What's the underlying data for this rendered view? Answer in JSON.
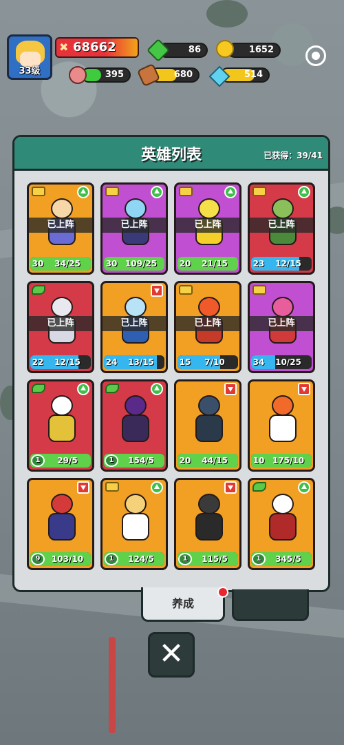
{
  "player": {
    "level_label": "33级",
    "power": "68662"
  },
  "resources": {
    "gems": "86",
    "coins": "1652",
    "meat": "395",
    "wood": "680",
    "crystal": "514"
  },
  "panel": {
    "title": "英雄列表",
    "obtained": "已获得：39/41"
  },
  "heroes": [
    {
      "color": "orange",
      "badge": "book",
      "arrow": "up",
      "deployed": "已上阵",
      "level": "30",
      "frags": "34/25",
      "bar": "green",
      "progress": 1.0
    },
    {
      "color": "purple",
      "badge": "book",
      "arrow": "up",
      "deployed": "已上阵",
      "level": "30",
      "frags": "109/25",
      "bar": "green",
      "progress": 1.0
    },
    {
      "color": "purple",
      "badge": "book",
      "arrow": "up",
      "deployed": "已上阵",
      "level": "20",
      "frags": "21/15",
      "bar": "green",
      "progress": 1.0
    },
    {
      "color": "red",
      "badge": "book",
      "arrow": "up",
      "deployed": "已上阵",
      "level": "23",
      "frags": "12/15",
      "bar": "blue",
      "progress": 0.8
    },
    {
      "color": "red",
      "badge": "leaf",
      "arrow": "",
      "deployed": "已上阵",
      "level": "22",
      "frags": "12/15",
      "bar": "blue",
      "progress": 0.8
    },
    {
      "color": "orange",
      "badge": "",
      "arrow": "down",
      "deployed": "已上阵",
      "level": "24",
      "frags": "13/15",
      "bar": "blue",
      "progress": 0.87
    },
    {
      "color": "orange",
      "badge": "book",
      "arrow": "",
      "deployed": "已上阵",
      "level": "15",
      "frags": "7/10",
      "bar": "blue",
      "progress": 0.7
    },
    {
      "color": "purple",
      "badge": "book",
      "arrow": "",
      "deployed": "已上阵",
      "level": "34",
      "frags": "10/25",
      "bar": "blue",
      "progress": 0.4
    },
    {
      "color": "red",
      "badge": "leaf",
      "arrow": "up",
      "deployed": "",
      "level": "1",
      "frags": "29/5",
      "bar": "green",
      "progress": 1.0
    },
    {
      "color": "red",
      "badge": "leaf",
      "arrow": "up",
      "deployed": "",
      "level": "1",
      "frags": "154/5",
      "bar": "green",
      "progress": 1.0
    },
    {
      "color": "orange",
      "badge": "",
      "arrow": "down",
      "deployed": "",
      "level": "20",
      "frags": "44/15",
      "bar": "green",
      "progress": 1.0
    },
    {
      "color": "orange",
      "badge": "",
      "arrow": "down",
      "deployed": "",
      "level": "10",
      "frags": "175/10",
      "bar": "green",
      "progress": 1.0
    },
    {
      "color": "orange",
      "badge": "",
      "arrow": "down",
      "deployed": "",
      "level": "9",
      "frags": "103/10",
      "bar": "green",
      "progress": 1.0
    },
    {
      "color": "orange",
      "badge": "book",
      "arrow": "up",
      "deployed": "",
      "level": "1",
      "frags": "124/5",
      "bar": "green",
      "progress": 1.0
    },
    {
      "color": "orange",
      "badge": "",
      "arrow": "down",
      "deployed": "",
      "level": "1",
      "frags": "115/5",
      "bar": "green",
      "progress": 1.0
    },
    {
      "color": "orange",
      "badge": "leaf",
      "arrow": "up",
      "deployed": "",
      "level": "1",
      "frags": "345/5",
      "bar": "green",
      "progress": 1.0
    }
  ],
  "tabs": {
    "cultivate": "养成"
  },
  "close_label": "✕",
  "colors": {
    "orange": "#f2a023",
    "purple": "#c04fd1",
    "red": "#d53a48",
    "panel_header": "#2f8a77"
  }
}
